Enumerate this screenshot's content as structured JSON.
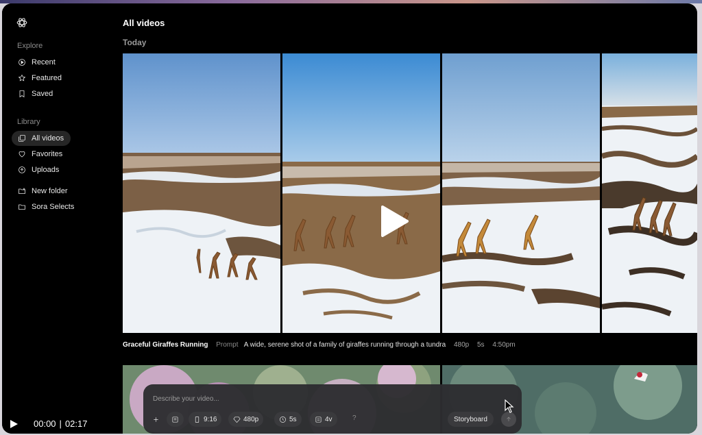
{
  "sidebar": {
    "explore_label": "Explore",
    "library_label": "Library",
    "explore_items": [
      {
        "label": "Recent",
        "icon": "play-circle-icon"
      },
      {
        "label": "Featured",
        "icon": "star-icon"
      },
      {
        "label": "Saved",
        "icon": "bookmark-icon"
      }
    ],
    "library_items": [
      {
        "label": "All videos",
        "icon": "videos-icon",
        "active": true
      },
      {
        "label": "Favorites",
        "icon": "heart-icon"
      },
      {
        "label": "Uploads",
        "icon": "upload-icon"
      }
    ],
    "folder_items": [
      {
        "label": "New folder",
        "icon": "new-folder-icon"
      },
      {
        "label": "Sora Selects",
        "icon": "folder-icon"
      }
    ]
  },
  "main": {
    "title": "All videos",
    "section": "Today",
    "video": {
      "title": "Graceful Giraffes Running",
      "prompt_label": "Prompt",
      "prompt": "A wide, serene shot of a family of giraffes running through a tundra",
      "resolution": "480p",
      "duration": "5s",
      "time": "4:50pm"
    }
  },
  "composer": {
    "placeholder": "Describe your video...",
    "aspect": "9:16",
    "resolution": "480p",
    "duration": "5s",
    "variations": "4v",
    "help": "?",
    "storyboard_label": "Storyboard"
  },
  "player": {
    "current": "00:00",
    "separator": "|",
    "total": "02:17"
  },
  "colors": {
    "background": "#000000",
    "sky": "#7fa6d3",
    "snow": "#eef2f6",
    "ground": "#7a5f43"
  }
}
